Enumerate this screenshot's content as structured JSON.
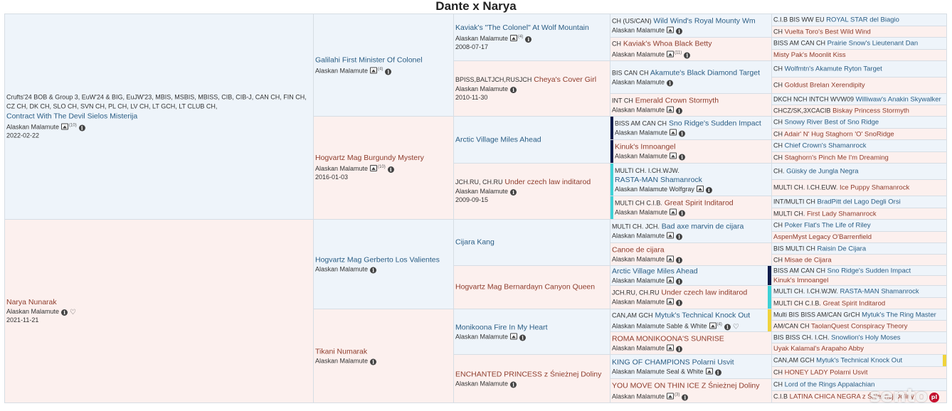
{
  "title": "Dante x Narya",
  "colors": {
    "male_bg": "#eef4fa",
    "female_bg": "#fcf0ee",
    "male_text": "#2a5d84",
    "female_text": "#8e3c2c",
    "navy": "#0d1b4b",
    "cyan": "#3ed1d6",
    "yellow": "#f0d33c"
  },
  "watermark": "sento",
  "watermark_badge": "pl",
  "g0": [
    {
      "titles": "Crufts'24 BOB & Group 3, EuW'24 & BIG, EuJW'23, MBIS, MSBIS, MBISS, CIB, CIB-J, CAN CH, FIN CH, CZ CH, DK CH, SLO CH, SVN CH, PL CH, LV CH, LT GCH, LT CLUB CH,",
      "name": "Contract With The Devil Sielos Misterija",
      "breed": "Alaskan Malamute",
      "photos": "(10)",
      "date": "2022-02-22"
    },
    {
      "titles": "",
      "name": "Narya Nunarak",
      "breed": "Alaskan Malamute",
      "date": "2021-11-21"
    }
  ],
  "g1": [
    {
      "name": "Galilahi First Minister Of Colonel",
      "breed": "Alaskan Malamute",
      "photos": "(4)",
      "date": ""
    },
    {
      "name": "Hogvartz Mag Burgundy Mystery",
      "breed": "Alaskan Malamute",
      "photos": "(10)",
      "date": "2016-01-03"
    },
    {
      "name": "Hogvartz Mag Gerberto Los Valientes",
      "breed": "Alaskan Malamute",
      "date": ""
    },
    {
      "name": "Tikani Numarak",
      "breed": "Alaskan Malamute",
      "date": ""
    }
  ],
  "g2": [
    {
      "titles": "",
      "name": "Kaviak's \"The Colonel\" At Wolf Mountain",
      "breed": "Alaskan Malamute",
      "photos": "(4)",
      "date": "2008-07-17"
    },
    {
      "titles": "BPISS,BALTJCH,RUSJCH",
      "name": "Cheya's Cover Girl",
      "breed": "Alaskan Malamute",
      "date": "2010-11-30"
    },
    {
      "titles": "",
      "name": "Arctic Village Miles Ahead",
      "breed": "",
      "date": ""
    },
    {
      "titles": "JCH.RU, CH.RU",
      "name": "Under czech law inditarod",
      "breed": "Alaskan Malamute",
      "date": "2009-09-15"
    },
    {
      "titles": "",
      "name": "Cijara Kang",
      "breed": "",
      "date": ""
    },
    {
      "titles": "",
      "name": "Hogvartz Mag Bernardayn Canyon Queen",
      "breed": "",
      "date": ""
    },
    {
      "titles": "",
      "name": "Monikoona Fire In My Heart",
      "breed": "Alaskan Malamute",
      "date": ""
    },
    {
      "titles": "",
      "name": "ENCHANTED PRINCESS z Śnieżnej Doliny",
      "breed": "Alaskan Malamute",
      "date": ""
    }
  ],
  "g3": [
    {
      "titles": "CH (US/CAN)",
      "name": "Wild Wind's Royal Mounty Wm",
      "breed": "Alaskan Malamute"
    },
    {
      "titles": "CH",
      "name": "Kaviak's Whoa Black Betty",
      "breed": "Alaskan Malamute",
      "photos": "(11)"
    },
    {
      "titles": "BIS CAN CH",
      "name": "Akamute's Black Diamond Target",
      "breed": "Alaskan Malamute"
    },
    {
      "titles": "INT CH",
      "name": "Emerald Crown Stormyth",
      "breed": "Alaskan Malamute"
    },
    {
      "titles": "BISS AM CAN CH",
      "name": "Sno Ridge's Sudden Impact",
      "breed": "Alaskan Malamute"
    },
    {
      "titles": "",
      "name": "Kinuk's Imnoangel",
      "breed": "Alaskan Malamute"
    },
    {
      "titles": "MULTI CH. I.CH.WJW.",
      "name": "RASTA-MAN Shamanrock",
      "breed": "Alaskan Malamute Wolfgray"
    },
    {
      "titles": "MULTI CH C.I.B.",
      "name": "Great Spirit Inditarod",
      "breed": "Alaskan Malamute"
    },
    {
      "titles": "MULTI CH. JCH.",
      "name": "Bad axe marvin de cijara",
      "breed": "Alaskan Malamute"
    },
    {
      "titles": "",
      "name": "Canoe de cijara",
      "breed": "Alaskan Malamute"
    },
    {
      "titles": "",
      "name": "Arctic Village Miles Ahead",
      "breed": "Alaskan Malamute"
    },
    {
      "titles": "JCH.RU, CH.RU",
      "name": "Under czech law inditarod",
      "breed": "Alaskan Malamute"
    },
    {
      "titles": "CAN,AM GCH",
      "name": "Mytuk's Technical Knock Out",
      "breed": "Alaskan Malamute Sable & White",
      "photos": "(4)"
    },
    {
      "titles": "",
      "name": "ROMA MONIKOONA'S SUNRISE",
      "breed": "Alaskan Malamute"
    },
    {
      "titles": "",
      "name": "KING OF CHAMPIONS Polarni Usvit",
      "breed": "Alaskan Malamute Seal & White"
    },
    {
      "titles": "",
      "name": "YOU MOVE ON THIN ICE Z Śnieżnej Doliny",
      "breed": "Alaskan Malamute",
      "photos": "(3)"
    }
  ],
  "g4": [
    {
      "titles": "C.I.B BIS WW EU",
      "name": "ROYAL STAR del Biagio"
    },
    {
      "titles": "CH",
      "name": "Vuelta Toro's Best Wild Wind"
    },
    {
      "titles": "BISS AM CAN CH",
      "name": "Prairie Snow's Lieutenant Dan"
    },
    {
      "titles": "",
      "name": "Misty Pak's Moonlit Kiss"
    },
    {
      "titles": "CH",
      "name": "Wolfmtn's Akamute Ryton Target"
    },
    {
      "titles": "CH",
      "name": "Goldust Brelan Xerendipity"
    },
    {
      "titles": "DKCH NCH INTCH WVW09",
      "name": "Williwaw's Anakin Skywalker"
    },
    {
      "titles": "CHCZ/SK,3XCACIB",
      "name": "Biskay Princess Stormyth"
    },
    {
      "titles": "CH",
      "name": "Snowy River Best of Sno Ridge"
    },
    {
      "titles": "CH",
      "name": "Adair' N' Hug Staghorn 'O' SnoRidge"
    },
    {
      "titles": "CH",
      "name": "Chief Crown's Shamanrock"
    },
    {
      "titles": "CH",
      "name": "Staghorn's Pinch Me I'm Dreaming"
    },
    {
      "titles": "CH.",
      "name": "Güisky de Jungla Negra"
    },
    {
      "titles": "MULTI CH. I.CH.EUW.",
      "name": "Ice Puppy Shamanrock"
    },
    {
      "titles": "INT/MULTI CH",
      "name": "BradPitt del Lago Degli Orsi"
    },
    {
      "titles": "MULTI CH.",
      "name": "First Lady Shamanrock"
    },
    {
      "titles": "CH",
      "name": "Poker Flat's The Life of Riley"
    },
    {
      "titles": "",
      "name": "AspenMyst Legacy O'Barrenfield"
    },
    {
      "titles": "BIS MULTI CH",
      "name": "Raisin De Cijara"
    },
    {
      "titles": "CH",
      "name": "Misae de Cijara"
    },
    {
      "titles": "BISS AM CAN CH",
      "name": "Sno Ridge's Sudden Impact"
    },
    {
      "titles": "",
      "name": "Kinuk's Imnoangel"
    },
    {
      "titles": "MULTI CH. I.CH.WJW.",
      "name": "RASTA-MAN Shamanrock"
    },
    {
      "titles": "MULTI CH C.I.B.",
      "name": "Great Spirit Inditarod"
    },
    {
      "titles": "Multi BIS BISS AM/CAN GrCH",
      "name": "Mytuk's The Ring Master"
    },
    {
      "titles": "AM/CAN CH",
      "name": "TaolanQuest Conspiracy Theory"
    },
    {
      "titles": "BIS BISS CH. I.CH.",
      "name": "Snowlion's Holy Moses"
    },
    {
      "titles": "",
      "name": "Uyak Kalamal's Arapaho Abby"
    },
    {
      "titles": "CAN,AM GCH",
      "name": "Mytuk's Technical Knock Out"
    },
    {
      "titles": "CH",
      "name": "HONEY LADY Polarni Usvit"
    },
    {
      "titles": "CH",
      "name": "Lord of the Rings Appalachian"
    },
    {
      "titles": "C.I.B",
      "name": "LATINA CHICA NEGRA z Śnieżnej Doliny"
    }
  ]
}
